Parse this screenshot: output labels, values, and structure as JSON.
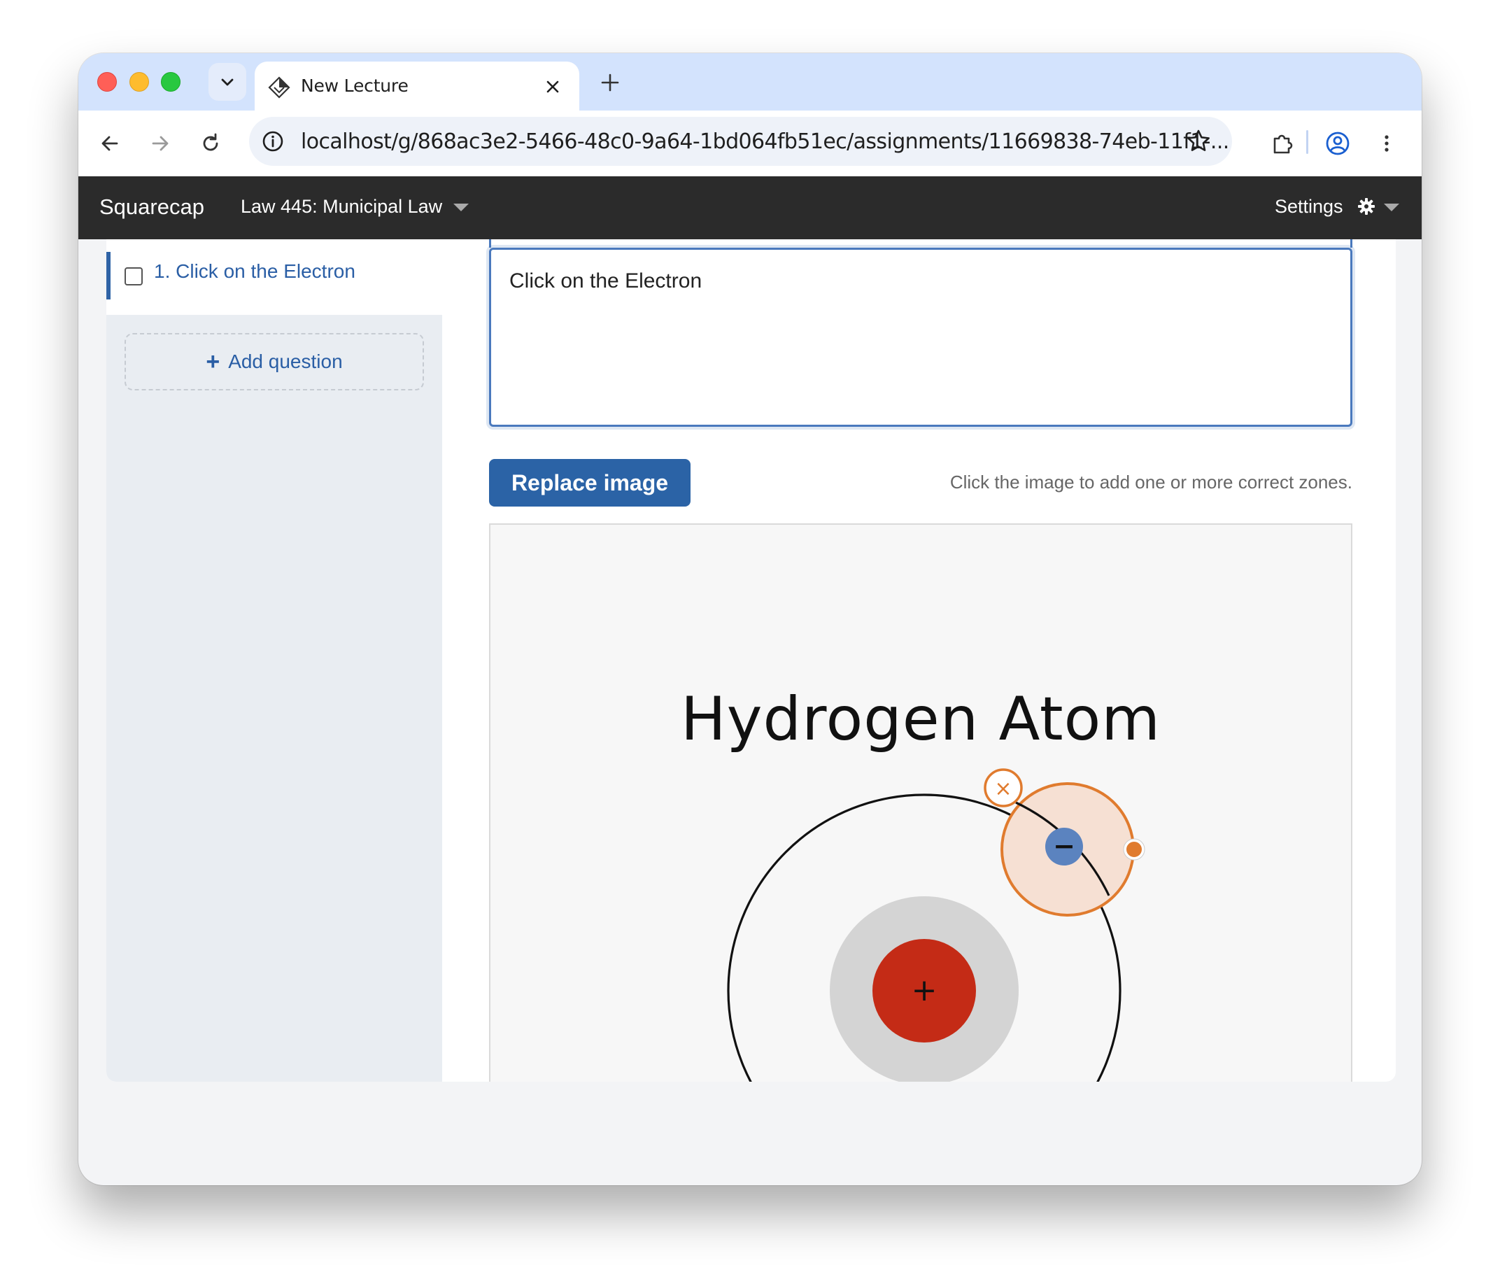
{
  "browser": {
    "tab_title": "New Lecture",
    "url": "localhost/g/868ac3e2-5466-48c0-9a64-1bd064fb51ec/assignments/11669838-74eb-11f1-..."
  },
  "app": {
    "brand": "Squarecap",
    "course": "Law 445: Municipal Law",
    "settings_label": "Settings"
  },
  "sidebar": {
    "questions": [
      {
        "label": "1. Click on the Electron",
        "checked": false,
        "selected": true
      }
    ],
    "add_question_label": "Add question"
  },
  "editor": {
    "prompt_text": "Click on the Electron",
    "replace_button_label": "Replace image",
    "hint": "Click the image to add one or more correct zones."
  },
  "image": {
    "title": "Hydrogen Atom",
    "nucleus_symbol": "+",
    "electron_symbol": "−",
    "zone_delete_symbol": "×",
    "colors": {
      "nucleus": "#c42b16",
      "nucleus_halo": "#d4d4d4",
      "electron": "#5b83bf",
      "zone_stroke": "#e07b2e",
      "zone_fill": "#f6e0d3"
    }
  },
  "colors": {
    "tabstrip": "#d3e3fd",
    "navbar": "#2b2b2b",
    "accent": "#2b63a6",
    "sidebar": "#e9edf2"
  }
}
